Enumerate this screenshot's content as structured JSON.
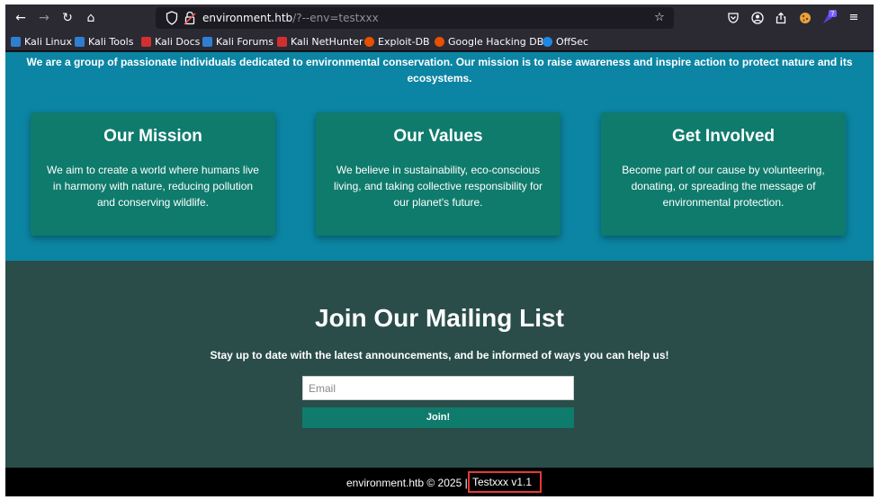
{
  "browser": {
    "url_host": "environment.htb",
    "url_path": "/?--env=testxxx",
    "extension_badge": "7",
    "bookmarks": [
      {
        "label": "Kali Linux",
        "color": "#2e7fd1"
      },
      {
        "label": "Kali Tools",
        "color": "#2e7fd1"
      },
      {
        "label": "Kali Docs",
        "color": "#d32f2f"
      },
      {
        "label": "Kali Forums",
        "color": "#2e7fd1"
      },
      {
        "label": "Kali NetHunter",
        "color": "#d32f2f"
      },
      {
        "label": "Exploit-DB",
        "color": "#e65100"
      },
      {
        "label": "Google Hacking DB",
        "color": "#e65100"
      },
      {
        "label": "OffSec",
        "color": "#1e88e5"
      }
    ]
  },
  "page": {
    "intro": "We are a group of passionate individuals dedicated to environmental conservation. Our mission is to raise awareness and inspire action to protect nature and its ecosystems.",
    "cards": [
      {
        "title": "Our Mission",
        "text": "We aim to create a world where humans live in harmony with nature, reducing pollution and conserving wildlife."
      },
      {
        "title": "Our Values",
        "text": "We believe in sustainability, eco-conscious living, and taking collective responsibility for our planet's future."
      },
      {
        "title": "Get Involved",
        "text": "Become part of our cause by volunteering, donating, or spreading the message of environmental protection."
      }
    ],
    "mailing": {
      "title": "Join Our Mailing List",
      "subtitle": "Stay up to date with the latest announcements, and be informed of ways you can help us!",
      "email_placeholder": "Email",
      "button": "Join!"
    },
    "footer": {
      "text": "environment.htb © 2025 |",
      "version": "Testxxx v1.1"
    }
  },
  "colors": {
    "hero_bg": "#0b85a3",
    "card_bg": "#0f7b6c",
    "mailing_bg": "#2a4d4a",
    "footer_bg": "#000000",
    "highlight_border": "#e53935"
  }
}
